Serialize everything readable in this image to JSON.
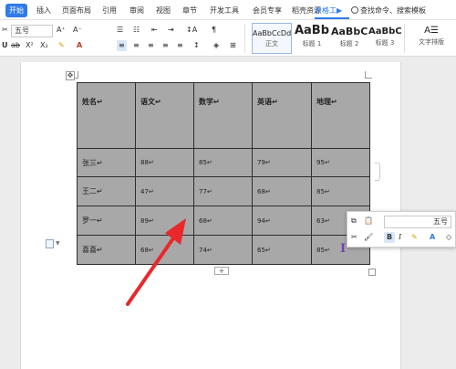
{
  "menu": {
    "items": [
      "开始",
      "插入",
      "页面布局",
      "引用",
      "审阅",
      "视图",
      "章节",
      "开发工具",
      "会员专享",
      "稻壳资源",
      "表格工▶"
    ],
    "search": "查找命令、搜索模板"
  },
  "ribbon": {
    "cut_glyph": "✂",
    "font_size": "五号",
    "size_up": "A⁺",
    "size_down": "A⁻",
    "superscript": "X²",
    "subscript": "X₂",
    "underline_glyph": "U",
    "strikethrough_glyph": "ab",
    "highlight_glyph": "✎",
    "font_color_glyph": "A",
    "list_bullets": "☰",
    "list_numbers": "☷",
    "indent_less": "⇤",
    "indent_more": "⇥",
    "sort": "↕A",
    "show_marks": "¶",
    "align_left": "≡",
    "align_center": "≡",
    "align_right": "≡",
    "justify": "≡",
    "distribute": "≡",
    "line_spacing": "↕",
    "shading": "◈",
    "borders": "⊞",
    "styles": [
      {
        "preview": "AaBbCcDd",
        "label": "正文"
      },
      {
        "preview": "AaBb",
        "label": "标题 1"
      },
      {
        "preview": "AaBbC",
        "label": "标题 2"
      },
      {
        "preview": "AaBbC",
        "label": "标题 3"
      }
    ],
    "text_layout_icon": "A☰",
    "text_layout": "文字排版"
  },
  "table": {
    "headers": [
      "姓名↵",
      "语文↵",
      "数学↵",
      "英语↵",
      "地理↵"
    ],
    "rows": [
      [
        "张三↵",
        "88↵",
        "85↵",
        "79↵",
        "95↵"
      ],
      [
        "王二↵",
        "47↵",
        "77↵",
        "68↵",
        "85↵"
      ],
      [
        "罗一↵",
        "89↵",
        "68↵",
        "94↵",
        "63↵"
      ],
      [
        "喜喜↵",
        "68↵",
        "74↵",
        "65↵",
        "85↵"
      ]
    ],
    "move_handle": "✥",
    "add_row": "+"
  },
  "mini_toolbar": {
    "copy": "⧉",
    "paste": "📋",
    "font_size": "五号",
    "cut": "✂",
    "format_painter": "🖌",
    "bold": "B",
    "italic": "I",
    "highlight": "✎",
    "font_color": "A",
    "erase": "◇"
  },
  "cursor_glyph": "I",
  "colors": {
    "accent": "#2f7bea",
    "table_fill": "#a8a8a8",
    "arrow": "#e8282b"
  }
}
